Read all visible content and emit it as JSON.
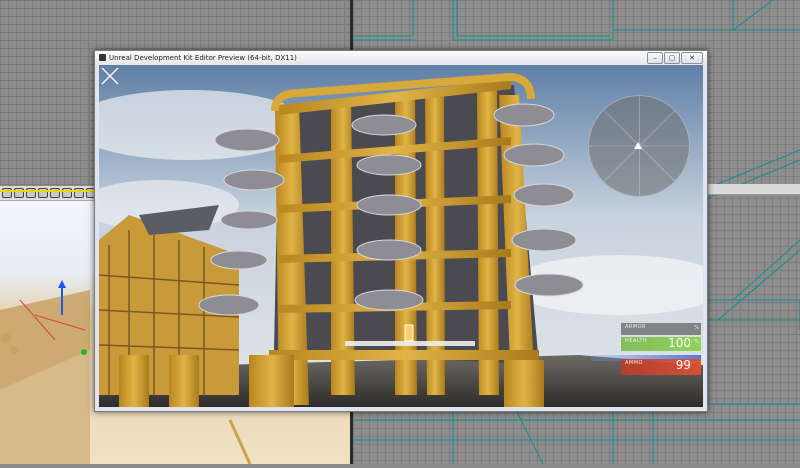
{
  "preview": {
    "title": "Unreal Development Kit Editor Preview (64-bit, DX11)",
    "buttons": {
      "minimize": "–",
      "maximize": "▢",
      "close": "✕"
    }
  },
  "hud": {
    "armor_label": "ARMOR",
    "armor_unit": "%",
    "health_label": "HEALTH",
    "health_value": "100",
    "health_unit": "%",
    "ammo_label": "AMMO",
    "ammo_value": "99"
  },
  "icons": [
    "window-app-icon",
    "crosshair-icon",
    "minimap-player-icon",
    "minimize-icon",
    "maximize-icon",
    "close-icon"
  ],
  "colors": {
    "wireframe": "#0f8f8f",
    "wood": "#d8a93a",
    "health": "#7fc44e",
    "ammo": "#d0533a"
  }
}
